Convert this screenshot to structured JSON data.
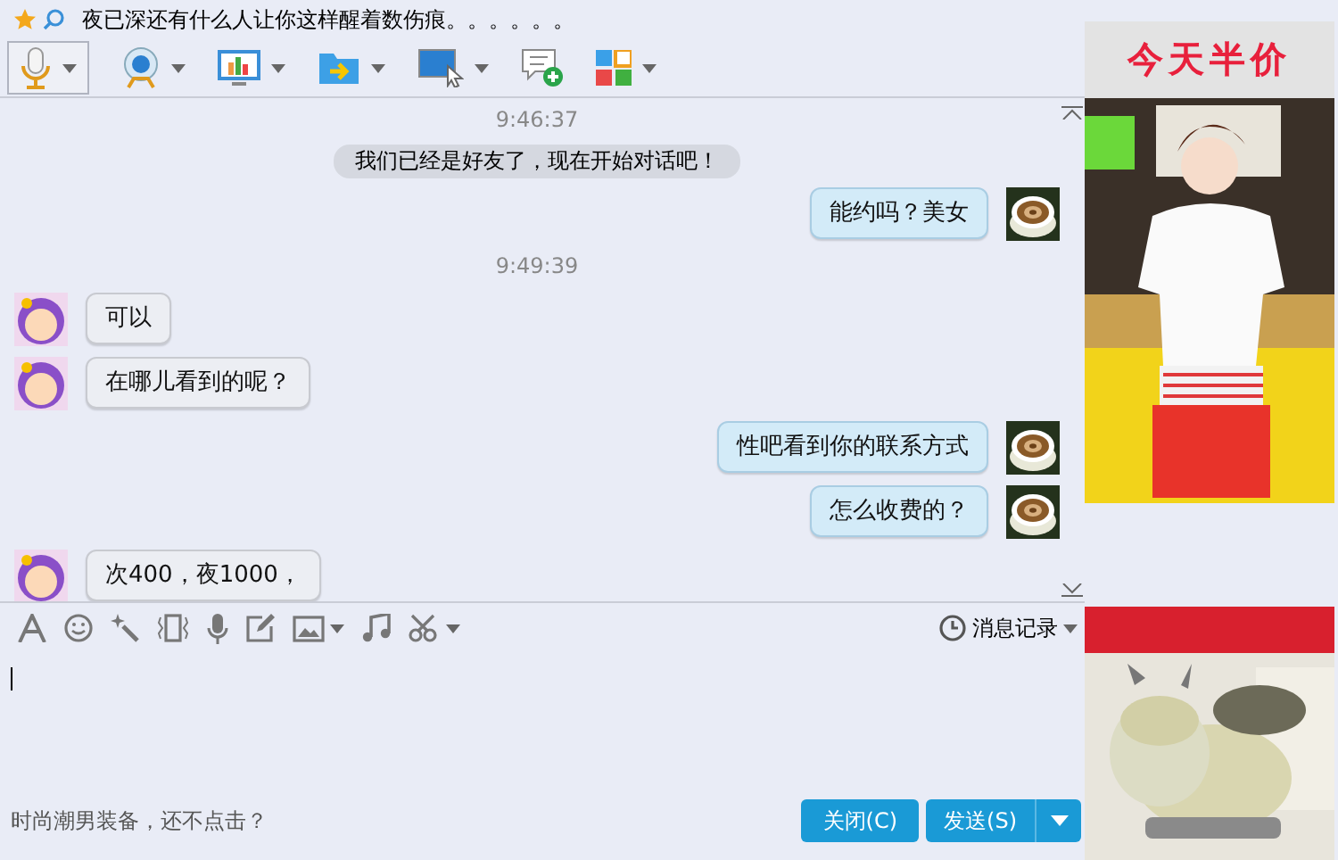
{
  "window": {
    "title": "夜已深还有什么人让你这样醒着数伤痕。。。。。。"
  },
  "messages": [
    {
      "kind": "time",
      "text": "9:46:37"
    },
    {
      "kind": "system",
      "text": "我们已经是好友了，现在开始对话吧！"
    },
    {
      "kind": "sent",
      "text": "能约吗？美女"
    },
    {
      "kind": "time",
      "text": "9:49:39"
    },
    {
      "kind": "received",
      "text": "可以"
    },
    {
      "kind": "received",
      "text": "在哪儿看到的呢？"
    },
    {
      "kind": "sent",
      "text": "性吧看到你的联系方式"
    },
    {
      "kind": "sent",
      "text": "怎么收费的？"
    },
    {
      "kind": "received",
      "text": "次400，夜1000，"
    }
  ],
  "history_button": "消息记录",
  "promo_link": "时尚潮男装备，还不点击？",
  "buttons": [
    {
      "label": "关闭(C)"
    },
    {
      "label": "发送(S)"
    }
  ],
  "ad": {
    "headline": "今天半价"
  }
}
